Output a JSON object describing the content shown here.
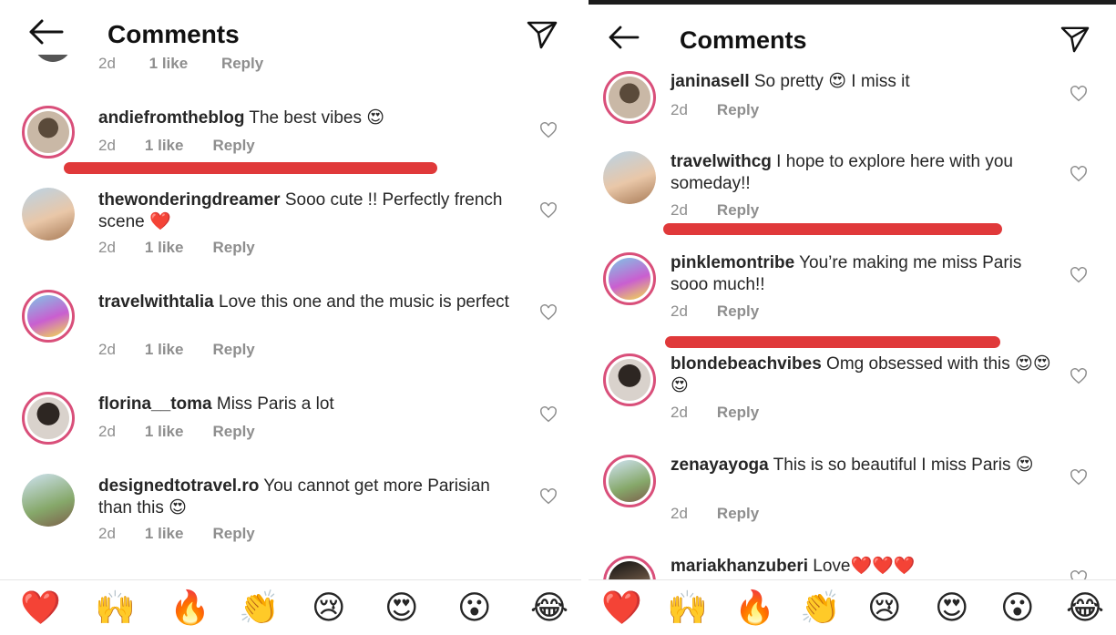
{
  "header": {
    "title": "Comments"
  },
  "left": {
    "partial_meta": [
      "2d",
      "1 like",
      "Reply"
    ],
    "comments": [
      {
        "username": "andiefromtheblog",
        "text": "The best vibes 😍",
        "time": "2d",
        "likes": "1 like",
        "reply": "Reply"
      },
      {
        "username": "thewonderingdreamer",
        "text": "Sooo cute !! Perfectly french scene ❤️",
        "time": "2d",
        "likes": "1 like",
        "reply": "Reply"
      },
      {
        "username": "travelwithtalia",
        "text": "Love this one and the music is perfect",
        "time": "2d",
        "likes": "1 like",
        "reply": "Reply"
      },
      {
        "username": "florina__toma",
        "text": "Miss Paris a lot",
        "time": "2d",
        "likes": "1 like",
        "reply": "Reply"
      },
      {
        "username": "designedtotravel.ro",
        "text": "You cannot get more Parisian than this 😍",
        "time": "2d",
        "likes": "1 like",
        "reply": "Reply"
      }
    ]
  },
  "right": {
    "comments": [
      {
        "username": "janinasell",
        "text": "So pretty 😍 I miss it",
        "time": "2d",
        "reply": "Reply"
      },
      {
        "username": "travelwithcg",
        "text": "I hope to explore here with you someday!!",
        "time": "2d",
        "reply": "Reply"
      },
      {
        "username": "pinklemontribe",
        "text": "You’re making me miss Paris sooo much!!",
        "time": "2d",
        "reply": "Reply"
      },
      {
        "username": "blondebeachvibes",
        "text": "Omg obsessed with this 😍😍😍",
        "time": "2d",
        "reply": "Reply"
      },
      {
        "username": "zenayayoga",
        "text": "This is so beautiful I miss Paris 😍",
        "time": "2d",
        "reply": "Reply"
      },
      {
        "username": "mariakhanzuberi",
        "text": "Love❤️❤️❤️",
        "time": "",
        "reply": ""
      }
    ]
  },
  "emoji_bar": [
    "❤️",
    "🙌",
    "🔥",
    "👏",
    "😢",
    "😍",
    "😮",
    "😂"
  ],
  "colors": {
    "highlight": "#e0393a",
    "ring": "#d94f7a",
    "meta": "#8e8e8e"
  }
}
